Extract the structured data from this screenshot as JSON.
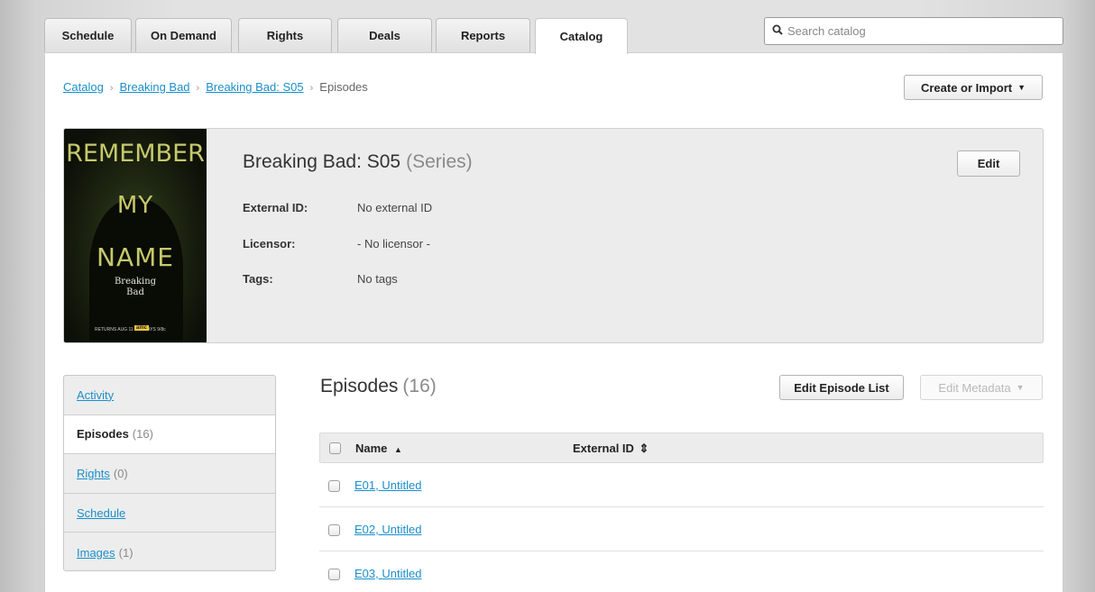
{
  "tabs": [
    "Schedule",
    "On Demand",
    "Rights",
    "Deals",
    "Reports",
    "Catalog"
  ],
  "active_tab": "Catalog",
  "search": {
    "placeholder": "Search catalog"
  },
  "breadcrumb": {
    "items": [
      "Catalog",
      "Breaking Bad",
      "Breaking Bad: S05"
    ],
    "current": "Episodes",
    "separator": "›"
  },
  "create_import_label": "Create or Import",
  "series": {
    "name": "Breaking Bad: S05",
    "type": "(Series)",
    "edit_label": "Edit",
    "fields": [
      {
        "label": "External ID:",
        "value": "No external ID"
      },
      {
        "label": "Licensor:",
        "value": "- No licensor -"
      },
      {
        "label": "Tags:",
        "value": "No tags"
      }
    ],
    "poster": {
      "line1": "REMEMBER",
      "line2": "MY",
      "line3": "NAME",
      "show_line1": "Breaking",
      "show_line2": "Bad",
      "small_text": "RETURNS AUG 11 SUNDAYS 9/8c",
      "network": "amc"
    }
  },
  "sidenav": [
    {
      "label": "Activity",
      "count": "",
      "link": true
    },
    {
      "label": "Episodes",
      "count": "(16)",
      "link": false
    },
    {
      "label": "Rights",
      "count": "(0)",
      "link": true
    },
    {
      "label": "Schedule",
      "count": "",
      "link": true
    },
    {
      "label": "Images",
      "count": "(1)",
      "link": true
    }
  ],
  "episodes": {
    "title": "Episodes",
    "count": "(16)",
    "edit_list_label": "Edit Episode List",
    "edit_metadata_label": "Edit Metadata",
    "columns": [
      {
        "label": "Name",
        "sort_icon": "▲"
      },
      {
        "label": "External ID",
        "sort_icon": "⇕"
      }
    ],
    "rows": [
      "E01, Untitled",
      "E02, Untitled",
      "E03, Untitled"
    ]
  },
  "colors": {
    "link": "#1a8fc9",
    "header_bg": "#ececec"
  }
}
